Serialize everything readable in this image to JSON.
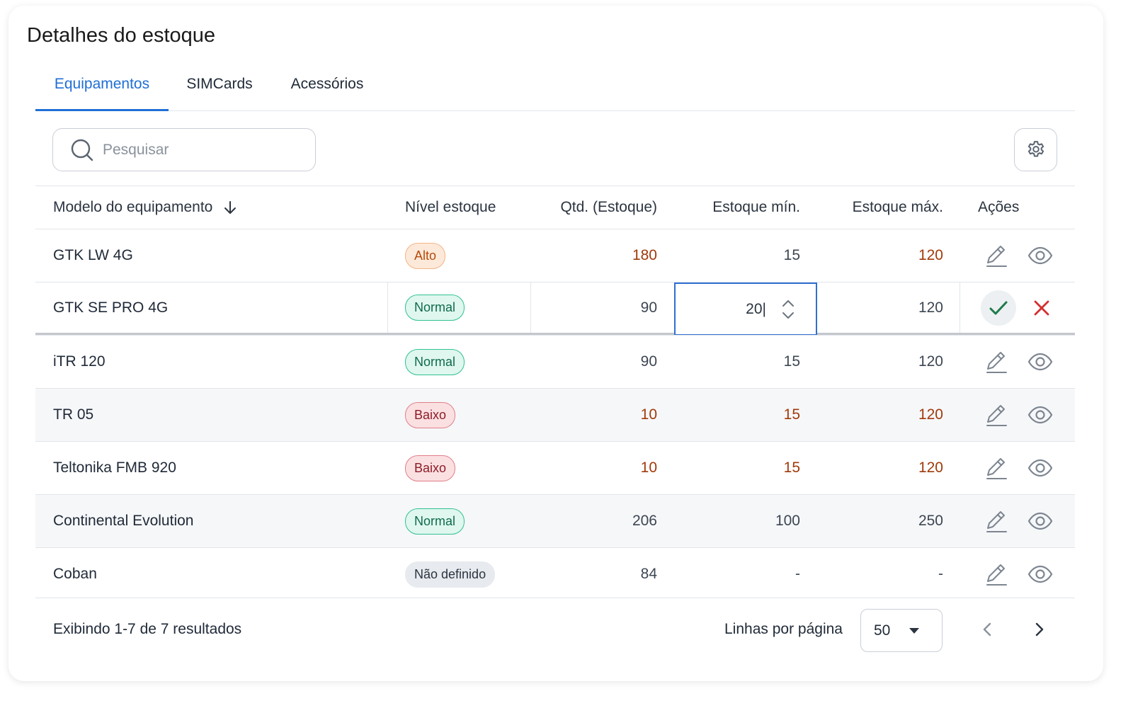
{
  "title": "Detalhes do estoque",
  "tabs": [
    {
      "label": "Equipamentos",
      "active": true
    },
    {
      "label": "SIMCards",
      "active": false
    },
    {
      "label": "Acessórios",
      "active": false
    }
  ],
  "search": {
    "placeholder": "Pesquisar",
    "value": ""
  },
  "table": {
    "headers": {
      "model": "Modelo do equipamento",
      "level": "Nível estoque",
      "qty": "Qtd. (Estoque)",
      "min": "Estoque mín.",
      "max": "Estoque máx.",
      "actions": "Ações"
    },
    "sort": {
      "column": "model",
      "direction": "desc"
    },
    "rows": [
      {
        "model": "GTK LW 4G",
        "level": "Alto",
        "qty": "180",
        "min": "15",
        "max": "120"
      },
      {
        "model": "GTK SE PRO 4G",
        "level": "Normal",
        "qty": "90",
        "min": "20|",
        "max": "120"
      },
      {
        "model": "iTR 120",
        "level": "Normal",
        "qty": "90",
        "min": "15",
        "max": "120"
      },
      {
        "model": "TR 05",
        "level": "Baixo",
        "qty": "10",
        "min": "15",
        "max": "120"
      },
      {
        "model": "Teltonika FMB 920",
        "level": "Baixo",
        "qty": "10",
        "min": "15",
        "max": "120"
      },
      {
        "model": "Continental Evolution",
        "level": "Normal",
        "qty": "206",
        "min": "100",
        "max": "250"
      },
      {
        "model": "Coban",
        "level": "Não definido",
        "qty": "84",
        "min": "-",
        "max": "-"
      }
    ]
  },
  "footer": {
    "summary": "Exibindo 1-7 de 7 resultados",
    "rows_per_page_label": "Linhas por página",
    "rows_per_page_value": "50"
  },
  "colors": {
    "accent": "#1f6fd6",
    "warning_text": "#a13a0b",
    "confirm": "#1e7a4c",
    "cancel": "#d32f2f"
  }
}
